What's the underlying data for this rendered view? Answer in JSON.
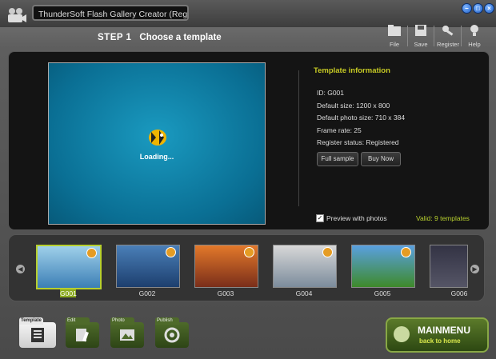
{
  "window": {
    "title": "ThunderSoft Flash Gallery Creator (Registered)",
    "controls": [
      "minimize",
      "maximize",
      "close"
    ]
  },
  "step": {
    "label": "STEP 1",
    "title": "Choose a template"
  },
  "toolbar": [
    {
      "label": "File",
      "icon": "file-icon"
    },
    {
      "label": "Save",
      "icon": "save-icon"
    },
    {
      "label": "Register",
      "icon": "register-icon"
    },
    {
      "label": "Help",
      "icon": "help-icon"
    }
  ],
  "preview": {
    "loading_text": "Loading..."
  },
  "info": {
    "title": "Template information",
    "lines": [
      "ID: G001",
      "Default size: 1200 x 800",
      "Default photo size: 710 x 384",
      "Frame rate: 25",
      "Register status: Registered"
    ],
    "full_sample": "Full sample",
    "buy_now": "Buy Now"
  },
  "options": {
    "preview_with_photos": "Preview with photos",
    "preview_checked": true,
    "valid_text": "Valid: 9 templates"
  },
  "templates": [
    {
      "id": "G001",
      "selected": true
    },
    {
      "id": "G002"
    },
    {
      "id": "G003"
    },
    {
      "id": "G004"
    },
    {
      "id": "G005"
    },
    {
      "id": "G006"
    }
  ],
  "nav": [
    {
      "label": "Template",
      "active": true
    },
    {
      "label": "Edit"
    },
    {
      "label": "Photo"
    },
    {
      "label": "Publish"
    }
  ],
  "mainmenu": {
    "title": "MAINMENU",
    "subtitle": "back to home"
  },
  "colors": {
    "accent": "#b7cf2e",
    "info_title": "#c6c924",
    "preview_bg": "#0a7aa0",
    "nav_green": "#4e6a2a"
  }
}
